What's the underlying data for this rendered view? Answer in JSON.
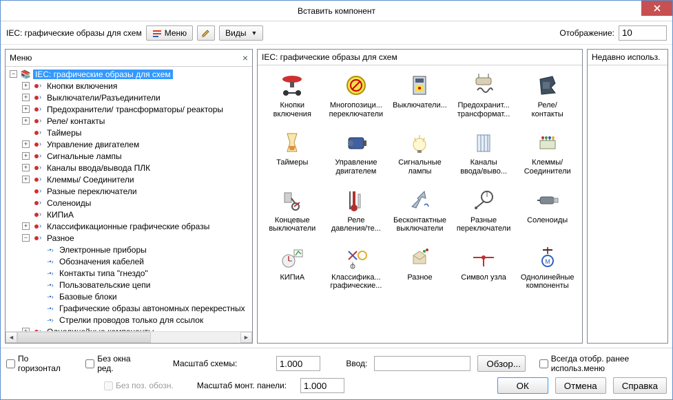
{
  "title": "Вставить компонент",
  "toolbar": {
    "caption": "IEC: графические образы для схем",
    "menu_btn": "Меню",
    "views_btn": "Виды",
    "display_label": "Отображение:",
    "display_value": "10"
  },
  "panels": {
    "left_title": "Меню",
    "mid_title": "IEC: графические образы для схем",
    "right_title": "Недавно использ."
  },
  "tree": {
    "root": "IEC: графические образы для схем",
    "items": [
      {
        "label": "Кнопки включения",
        "exp": true
      },
      {
        "label": "Выключатели/Разъединители",
        "exp": true
      },
      {
        "label": "Предохранители/ трансформаторы/ реакторы",
        "exp": true
      },
      {
        "label": "Реле/ контакты",
        "exp": true
      },
      {
        "label": "Таймеры",
        "exp": false
      },
      {
        "label": "Управление двигателем",
        "exp": true
      },
      {
        "label": "Сигнальные лампы",
        "exp": true
      },
      {
        "label": "Каналы ввода/вывода ПЛК",
        "exp": true
      },
      {
        "label": "Клеммы/ Соединители",
        "exp": true
      },
      {
        "label": "Разные переключатели",
        "exp": false
      },
      {
        "label": "Соленоиды",
        "exp": false
      },
      {
        "label": "КИПиА",
        "exp": false
      },
      {
        "label": "Классификационные графические образы",
        "exp": true
      },
      {
        "label": "Разное",
        "exp": true,
        "open": true,
        "children": [
          "Электронные приборы",
          "Обозначения кабелей",
          "Контакты типа \"гнездо\"",
          "Пользовательские цепи",
          "Базовые блоки",
          "Графические образы автономных перекрестных",
          "Стрелки проводов только для ссылок"
        ]
      },
      {
        "label": "Однолинейные компоненты",
        "exp": true
      }
    ]
  },
  "grid": [
    {
      "l1": "Кнопки",
      "l2": "включения"
    },
    {
      "l1": "Многопозици...",
      "l2": "переключатели"
    },
    {
      "l1": "Выключатели...",
      "l2": ""
    },
    {
      "l1": "Предохранит...",
      "l2": "трансформат..."
    },
    {
      "l1": "Реле/",
      "l2": "контакты"
    },
    {
      "l1": "Таймеры",
      "l2": ""
    },
    {
      "l1": "Управление",
      "l2": "двигателем"
    },
    {
      "l1": "Сигнальные",
      "l2": "лампы"
    },
    {
      "l1": "Каналы",
      "l2": "ввода/выво..."
    },
    {
      "l1": "Клеммы/",
      "l2": "Соединители"
    },
    {
      "l1": "Концевые",
      "l2": "выключатели"
    },
    {
      "l1": "Реле",
      "l2": "давления/те..."
    },
    {
      "l1": "Бесконтактные",
      "l2": "выключатели"
    },
    {
      "l1": "Разные",
      "l2": "переключатели"
    },
    {
      "l1": "Соленоиды",
      "l2": ""
    },
    {
      "l1": "КИПиА",
      "l2": ""
    },
    {
      "l1": "Классифика...",
      "l2": "графические..."
    },
    {
      "l1": "Разное",
      "l2": ""
    },
    {
      "l1": "Символ узла",
      "l2": ""
    },
    {
      "l1": "Однолинейные",
      "l2": "компоненты"
    }
  ],
  "bottom": {
    "chk_horiz": "По горизонтал",
    "chk_no_edit": "Без окна ред.",
    "chk_no_pos": "Без поз. обозн.",
    "scale_scheme": "Масштаб схемы:",
    "scale_panel": "Масштаб монт. панели:",
    "scale_val": "1.000",
    "input_label": "Ввод:",
    "browse": "Обзор...",
    "chk_always": "Всегда отобр. ранее использ.меню",
    "ok": "ОК",
    "cancel": "Отмена",
    "help": "Справка"
  }
}
